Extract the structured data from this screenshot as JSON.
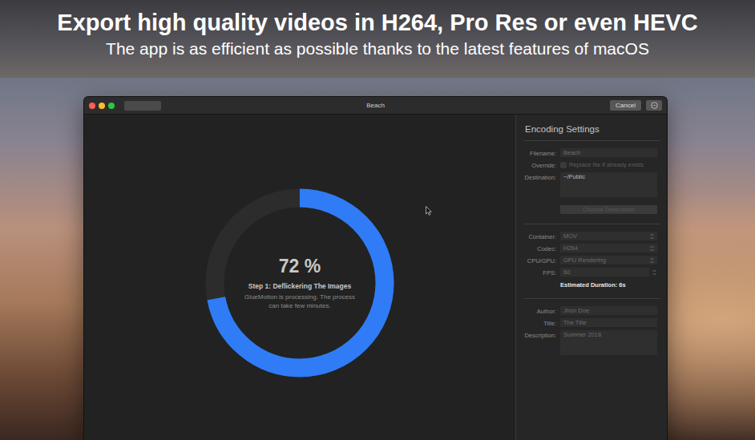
{
  "banner": {
    "headline": "Export high quality videos in H264, Pro Res or even HEVC",
    "subtitle": "The app is as efficient as possible thanks to the latest features of macOS"
  },
  "window": {
    "title": "Beach",
    "cancel_button": "Cancel"
  },
  "progress": {
    "level": 0.72,
    "percent": "72 %",
    "step": "Step 1: Deflickering The Images",
    "message": "GlueMotion is processing. The process can take few minutes."
  },
  "settings": {
    "title": "Encoding Settings",
    "sections": [
      [
        {
          "kind": "text",
          "label": "Filename:",
          "value": "Beach"
        },
        {
          "kind": "checkbox",
          "label": "Override:",
          "value": "Replace file if already exists",
          "checked": false
        },
        {
          "kind": "textarea",
          "label": "Destination:",
          "value": "~/Public"
        },
        {
          "kind": "button",
          "value": "Choose Destination",
          "disabled": true
        }
      ],
      [
        {
          "kind": "select",
          "label": "Container:",
          "value": "MOV"
        },
        {
          "kind": "select",
          "label": "Codec:",
          "value": "H264"
        },
        {
          "kind": "select",
          "label": "CPU/GPU:",
          "value": "GPU Rendering"
        },
        {
          "kind": "stepper",
          "label": "FPS:",
          "value": "60"
        },
        {
          "kind": "info",
          "value": "Estimated Duration: 6s"
        }
      ],
      [
        {
          "kind": "text",
          "label": "Author:",
          "value": "Jhon Doe"
        },
        {
          "kind": "text",
          "label": "Title:",
          "value": "The Title"
        },
        {
          "kind": "textarea",
          "label": "Description:",
          "value": "Summer 2018"
        }
      ]
    ]
  }
}
